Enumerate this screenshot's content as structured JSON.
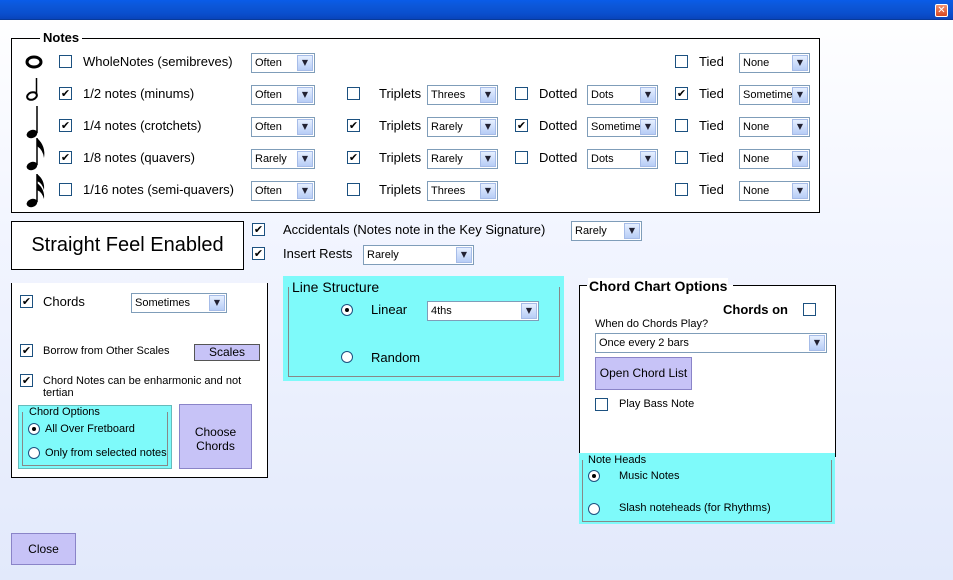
{
  "window": {
    "close_glyph": "✕"
  },
  "notes": {
    "legend": "Notes",
    "rows": [
      {
        "icon": "whole-note-icon",
        "label": "WholeNotes (semibreves)",
        "checked": false,
        "freq": "Often",
        "triplets": null,
        "dotted": null,
        "tied": false,
        "tied_value": "None"
      },
      {
        "icon": "half-note-icon",
        "label": "1/2 notes (minums)",
        "checked": true,
        "freq": "Often",
        "triplets": {
          "label": "Triplets",
          "checked": false,
          "value": "Threes"
        },
        "dotted": {
          "label": "Dotted",
          "checked": false,
          "value": "Dots"
        },
        "tied": true,
        "tied_value": "Sometime"
      },
      {
        "icon": "quarter-note-icon",
        "label": "1/4 notes (crotchets)",
        "checked": true,
        "freq": "Often",
        "triplets": {
          "label": "Triplets",
          "checked": true,
          "value": "Rarely"
        },
        "dotted": {
          "label": "Dotted",
          "checked": true,
          "value": "Sometime"
        },
        "tied": false,
        "tied_value": "None"
      },
      {
        "icon": "eighth-note-icon",
        "label": "1/8 notes (quavers)",
        "checked": true,
        "freq": "Rarely",
        "triplets": {
          "label": "Triplets",
          "checked": true,
          "value": "Rarely"
        },
        "dotted": {
          "label": "Dotted",
          "checked": false,
          "value": "Dots"
        },
        "tied": false,
        "tied_value": "None"
      },
      {
        "icon": "sixteenth-note-icon",
        "label": "1/16 notes (semi-quavers)",
        "checked": false,
        "freq": "Often",
        "triplets": {
          "label": "Triplets",
          "checked": false,
          "value": "Threes"
        },
        "dotted": null,
        "tied": false,
        "tied_value": "None"
      }
    ],
    "tied_label": "Tied"
  },
  "feel": {
    "label": "Straight Feel Enabled"
  },
  "accidentals": {
    "label": "Accidentals (Notes note in the Key Signature)",
    "checked": true,
    "value": "Rarely"
  },
  "rests": {
    "label": "Insert Rests",
    "checked": true,
    "value": "Rarely"
  },
  "chords": {
    "label": "Chords",
    "checked": true,
    "value": "Sometimes",
    "borrow_label": "Borrow from Other Scales",
    "borrow_checked": true,
    "scales_button": "Scales",
    "enharmonic_label_1": "Chord Notes can be enharmonic and not",
    "enharmonic_label_2": "tertian",
    "enharmonic_checked": true,
    "options_legend": "Chord Options",
    "opt_all": "All Over Fretboard",
    "opt_selected": "Only from selected notes",
    "choose_1": "Choose",
    "choose_2": "Chords"
  },
  "line_structure": {
    "legend": "Line Structure",
    "linear": "Linear",
    "linear_value": "4ths",
    "random": "Random"
  },
  "chord_chart": {
    "legend": "Chord Chart Options",
    "chords_on": "Chords on",
    "chords_on_checked": false,
    "when_label": "When do Chords Play?",
    "when_value": "Once every 2 bars",
    "open_list": "Open Chord List",
    "bass_label": "Play Bass Note",
    "bass_checked": false
  },
  "note_heads": {
    "legend": "Note Heads",
    "music": "Music Notes",
    "slash": "Slash noteheads (for Rhythms)"
  },
  "close_button": "Close",
  "check_glyph": "✔",
  "arrow_glyph": "▼"
}
